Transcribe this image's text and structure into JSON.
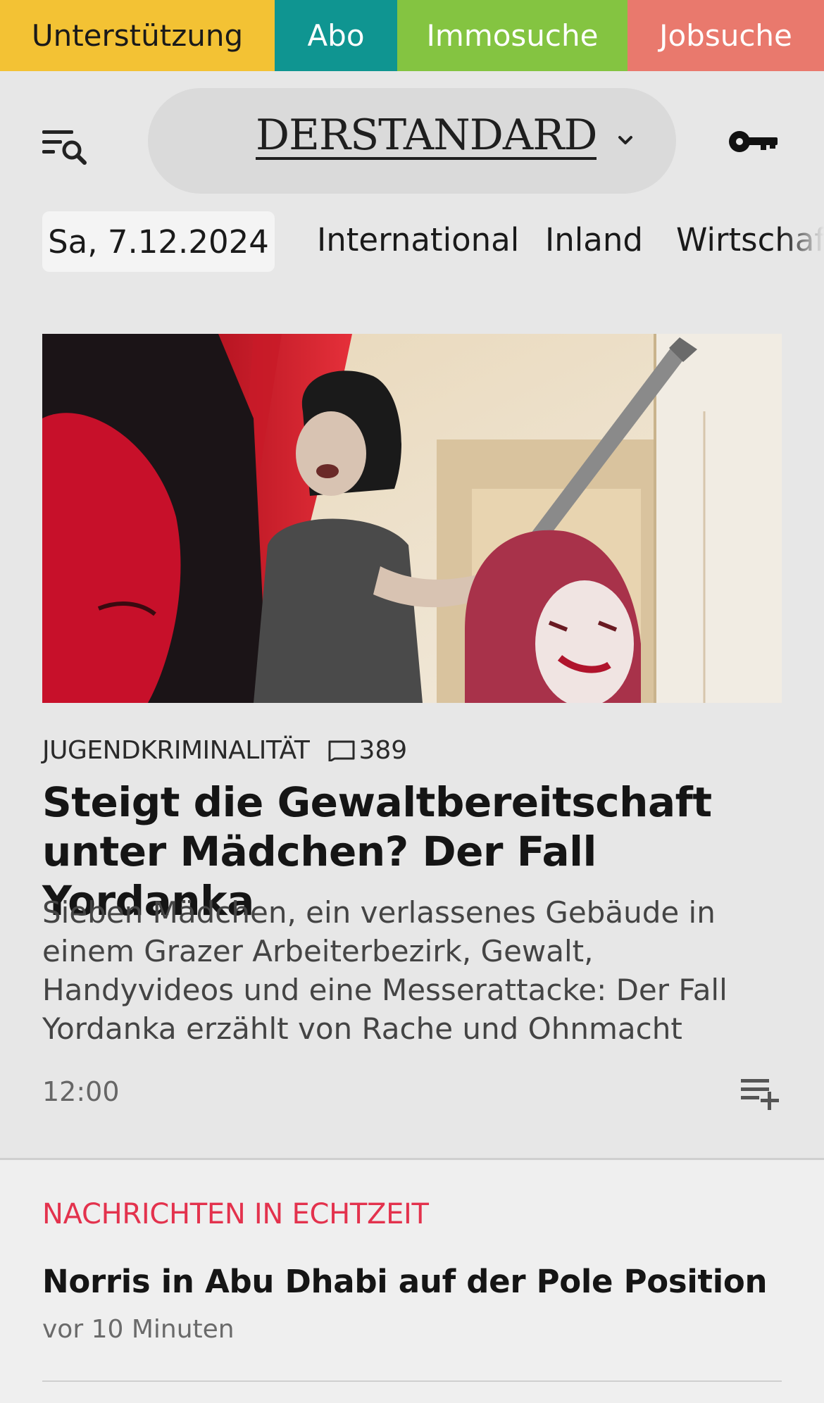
{
  "topbar": {
    "items": [
      {
        "label": "Unterstützung",
        "color": "#f3c234"
      },
      {
        "label": "Abo",
        "color": "#0f9591"
      },
      {
        "label": "Immosuche",
        "color": "#84c441"
      },
      {
        "label": "Jobsuche",
        "color": "#e9796d"
      }
    ]
  },
  "header": {
    "menu_icon": "menu-search-icon",
    "logo": "DERSTANDARD",
    "logo_dropdown_icon": "chevron-down-icon",
    "login_icon": "key-icon"
  },
  "nav": {
    "date": "Sa, 7.12.2024",
    "sections": [
      "International",
      "Inland",
      "Wirtschaft"
    ]
  },
  "article": {
    "image_alt": "Illustration: Mädchen mit Baseballschläger",
    "kicker": "JUGENDKRIMINALITÄT",
    "comment_icon": "comment-icon",
    "comment_count": "389",
    "headline": "Steigt die Gewaltbereitschaft unter Mädchen? Der Fall Yordanka",
    "teaser": "Sieben Mädchen, ein verlassenes Gebäude in einem Grazer Arbeiterbezirk, Gewalt, Handyvideos und eine Messerattacke: Der Fall Yordanka erzählt von Rache und Ohnmacht",
    "time": "12:00",
    "save_icon": "playlist-add-icon"
  },
  "live": {
    "label": "NACHRICHTEN IN ECHTZEIT",
    "label_color": "#e3324d",
    "items": [
      {
        "headline": "Norris in Abu Dhabi auf der Pole Position",
        "time": "vor 10 Minuten"
      }
    ]
  }
}
